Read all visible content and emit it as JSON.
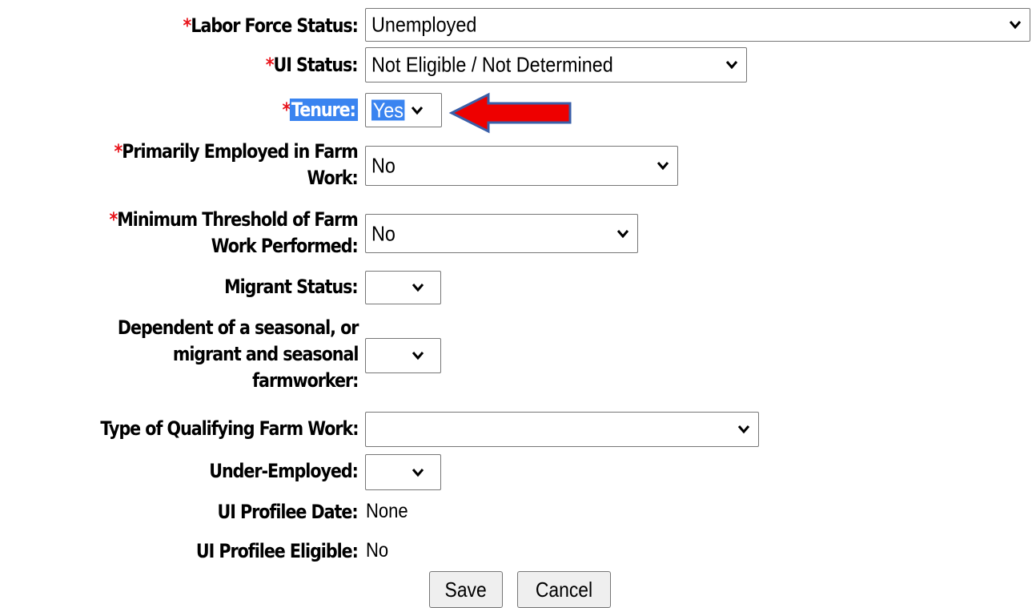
{
  "required_mark": "*",
  "fields": {
    "labor_force_status": {
      "label": "Labor Force Status:",
      "value": "Unemployed"
    },
    "ui_status": {
      "label": "UI Status:",
      "value": "Not Eligible / Not Determined"
    },
    "tenure": {
      "label": "Tenure:",
      "value": "Yes"
    },
    "primarily_employed": {
      "label_line1": "Primarily Employed in Farm",
      "label_line2": "Work:",
      "value": "No"
    },
    "minimum_threshold": {
      "label_line1": "Minimum Threshold of Farm",
      "label_line2": "Work Performed:",
      "value": "No"
    },
    "migrant_status": {
      "label": "Migrant Status:",
      "value": ""
    },
    "dependent": {
      "label_line1": "Dependent of a seasonal, or",
      "label_line2": "migrant and seasonal",
      "label_line3": "farmworker:",
      "value": ""
    },
    "type_of_farm_work": {
      "label": "Type of Qualifying Farm Work:",
      "value": ""
    },
    "under_employed": {
      "label": "Under-Employed:",
      "value": ""
    },
    "ui_profilee_date": {
      "label": "UI Profilee Date:",
      "value": "None"
    },
    "ui_profilee_eligible": {
      "label": "UI Profilee Eligible:",
      "value": "No"
    }
  },
  "buttons": {
    "save": "Save",
    "cancel": "Cancel"
  },
  "colors": {
    "required": "#e8141b",
    "highlight": "#3a84f0",
    "arrow": "#ee0000",
    "arrow_outline": "#3a5fa8"
  }
}
